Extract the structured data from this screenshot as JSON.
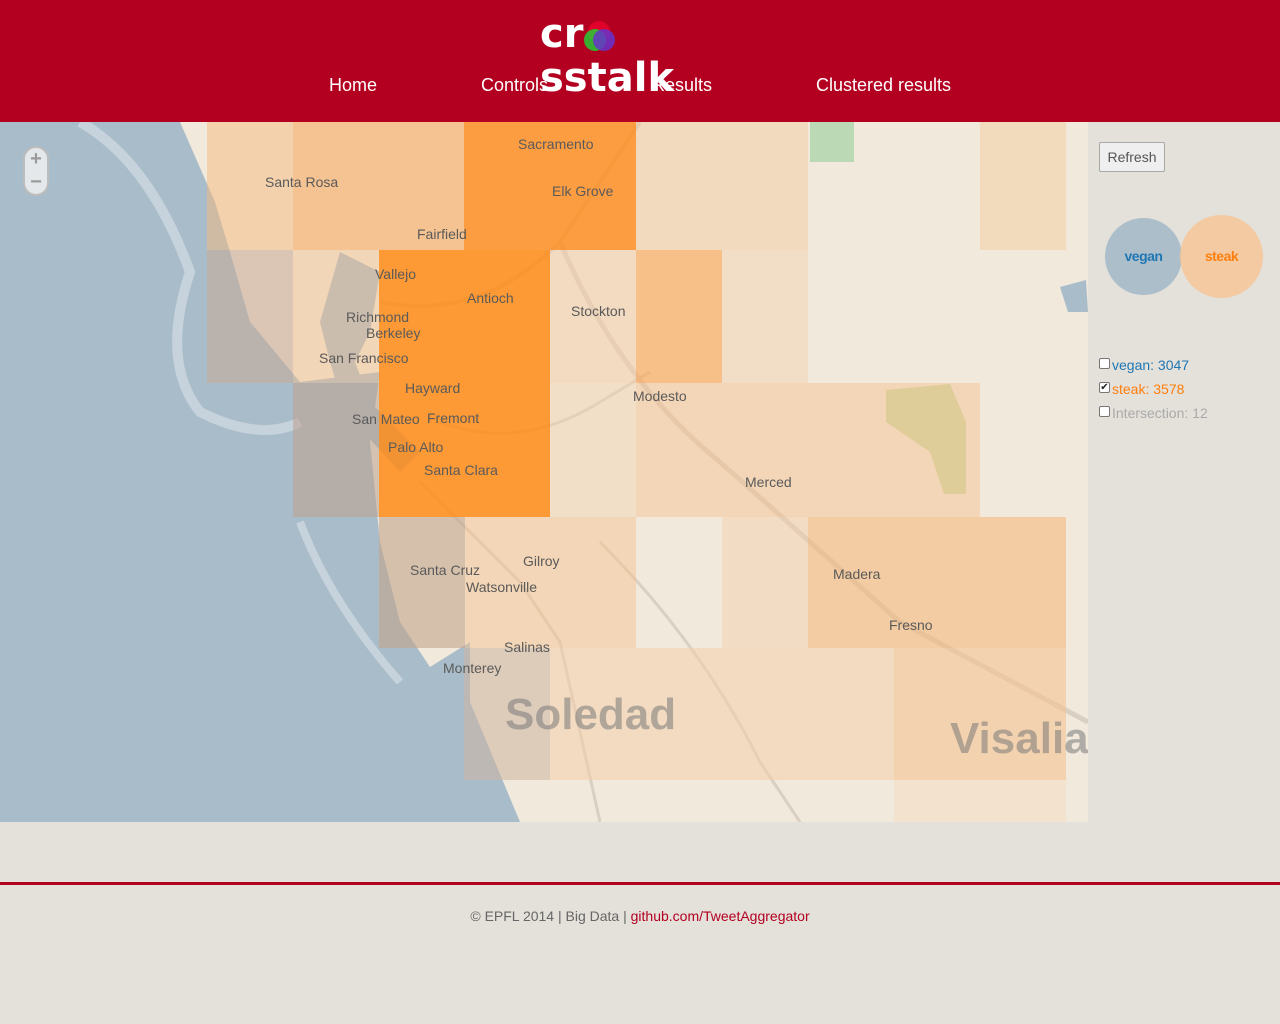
{
  "app": {
    "logo": {
      "left": "cr",
      "right": "sstalk"
    },
    "colors": {
      "brand": "#b30021",
      "vegan": "#1f77b4",
      "steak": "#ff7f0e",
      "intersection": "#aaaaaa"
    }
  },
  "nav": {
    "items": [
      "Home",
      "Controls",
      "Results",
      "Clustered results"
    ]
  },
  "map": {
    "zoom_in": "+",
    "zoom_out": "−",
    "places": [
      "Sacramento",
      "Santa Rosa",
      "Elk Grove",
      "Fairfield",
      "Vallejo",
      "Antioch",
      "Richmond",
      "Berkeley",
      "Stockton",
      "San Francisco",
      "Modesto",
      "Hayward",
      "San Mateo",
      "Fremont",
      "Palo Alto",
      "Santa Clara",
      "Merced",
      "Gilroy",
      "Santa Cruz",
      "Watsonville",
      "Madera",
      "Fresno",
      "Salinas",
      "Monterey"
    ],
    "big_places": [
      "Soledad",
      "Visalia"
    ]
  },
  "panel": {
    "refresh_label": "Refresh",
    "bubbles": {
      "vegan": "vegan",
      "steak": "steak"
    },
    "legend": {
      "vegan": {
        "label": "vegan: 3047",
        "checked": false
      },
      "steak": {
        "label": "steak: 3578",
        "checked": true
      },
      "intersection": {
        "label": "Intersection: 12",
        "checked": false
      }
    },
    "check_mark": "✔"
  },
  "footer": {
    "text": "© EPFL 2014 | Big Data | ",
    "link": "github.com/TweetAggregator"
  }
}
